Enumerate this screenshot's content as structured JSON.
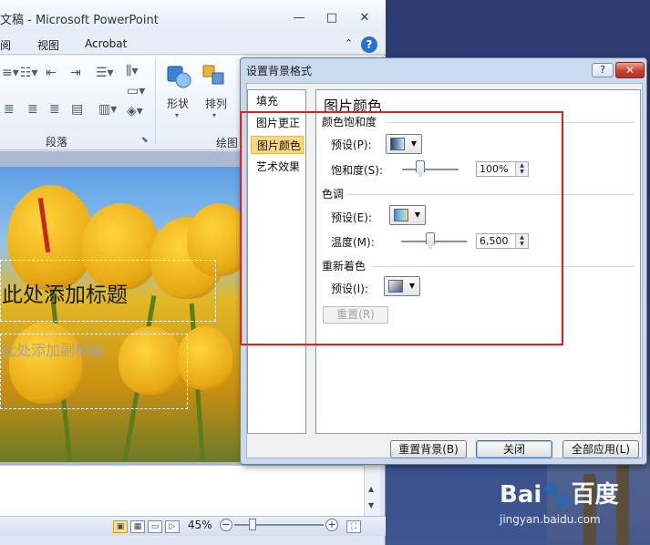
{
  "ppt": {
    "title": "文稿 - Microsoft PowerPoint",
    "menu": [
      "阅",
      "视图",
      "Acrobat"
    ],
    "ribbon": {
      "shape_label": "形状",
      "arrange_label": "排列",
      "group_paragraph": "段落",
      "group_draw": "绘图"
    },
    "slide": {
      "title_placeholder": "此处添加标题",
      "subtitle_placeholder": "此处添加副标题"
    },
    "status": {
      "zoom": "45%"
    }
  },
  "dialog": {
    "title": "设置背景格式",
    "help": "?",
    "close": "✕",
    "nav": [
      "填充",
      "图片更正",
      "图片颜色",
      "艺术效果"
    ],
    "active_nav": 2,
    "heading": "图片颜色",
    "saturation": {
      "section": "颜色饱和度",
      "preset_label": "预设(P):",
      "amount_label": "饱和度(S):",
      "value": "100%",
      "slider_level": 0.5
    },
    "tone": {
      "section": "色调",
      "preset_label": "预设(E):",
      "amount_label": "温度(M):",
      "value": "6,500",
      "slider_level": 0.5
    },
    "recolor": {
      "section": "重新着色",
      "preset_label": "预设(I):",
      "reset": "重置(R)"
    },
    "buttons": {
      "reset_background": "重置背景(B)",
      "close": "关闭",
      "apply_all": "全部应用(L)"
    }
  },
  "watermark": {
    "brand": "Bai🐾百度",
    "sub": "jingyan.baidu.com"
  },
  "colors": {
    "dialog_bg": "#c9d9ee",
    "active_nav": "#ffd87a",
    "highlight_box": "#e02020"
  }
}
